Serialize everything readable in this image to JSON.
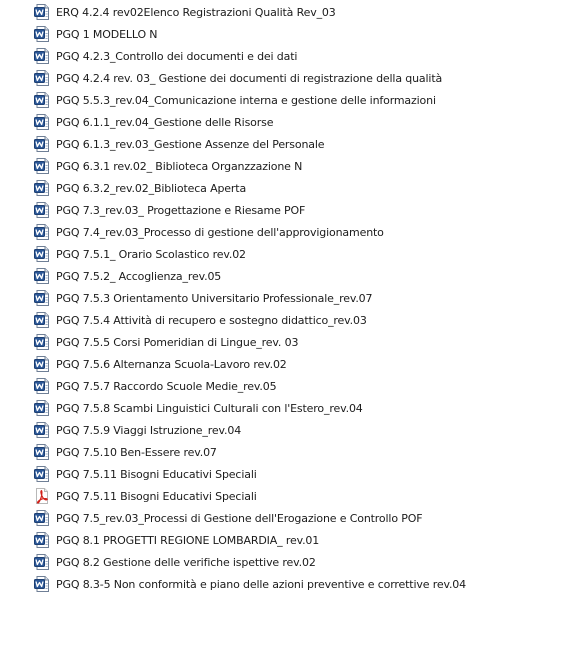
{
  "files": [
    {
      "name": "ERQ 4.2.4 rev02Elenco Registrazioni Qualità Rev_03",
      "icon": "word-doc-icon"
    },
    {
      "name": "PGQ 1 MODELLO N",
      "icon": "word-doc-icon"
    },
    {
      "name": "PGQ 4.2.3_Controllo dei documenti e dei dati",
      "icon": "word-doc-icon"
    },
    {
      "name": "PGQ 4.2.4  rev. 03_ Gestione dei documenti di registrazione della qualità",
      "icon": "word-doc-icon"
    },
    {
      "name": "PGQ 5.5.3_rev.04_Comunicazione interna e gestione delle informazioni",
      "icon": "word-doc-icon"
    },
    {
      "name": "PGQ 6.1.1_rev.04_Gestione delle Risorse",
      "icon": "word-doc-icon"
    },
    {
      "name": "PGQ 6.1.3_rev.03_Gestione Assenze del Personale",
      "icon": "word-doc-icon"
    },
    {
      "name": "PGQ 6.3.1 rev.02_ Biblioteca Organzzazione N",
      "icon": "word-doc-icon"
    },
    {
      "name": "PGQ 6.3.2_rev.02_Biblioteca Aperta",
      "icon": "word-doc-icon"
    },
    {
      "name": "PGQ 7.3_rev.03_ Progettazione e Riesame POF",
      "icon": "word-doc-icon"
    },
    {
      "name": "PGQ 7.4_rev.03_Processo di gestione dell'approvigionamento",
      "icon": "word-doc-icon"
    },
    {
      "name": "PGQ 7.5.1_ Orario Scolastico rev.02",
      "icon": "word-doc-icon"
    },
    {
      "name": "PGQ 7.5.2_ Accoglienza_rev.05",
      "icon": "word-doc-icon"
    },
    {
      "name": "PGQ 7.5.3 Orientamento Universitario Professionale_rev.07",
      "icon": "word-doc-icon"
    },
    {
      "name": "PGQ 7.5.4 Attività di recupero e sostegno didattico_rev.03",
      "icon": "word-doc-icon"
    },
    {
      "name": "PGQ 7.5.5 Corsi Pomeridian di Lingue_rev. 03",
      "icon": "word-doc-icon"
    },
    {
      "name": "PGQ 7.5.6 Alternanza Scuola-Lavoro rev.02",
      "icon": "word-doc-icon"
    },
    {
      "name": "PGQ 7.5.7 Raccordo Scuole Medie_rev.05",
      "icon": "word-doc-icon"
    },
    {
      "name": "PGQ 7.5.8 Scambi Linguistici Culturali con l'Estero_rev.04",
      "icon": "word-doc-icon"
    },
    {
      "name": "PGQ 7.5.9 Viaggi Istruzione_rev.04",
      "icon": "word-doc-icon"
    },
    {
      "name": "PGQ 7.5.10 Ben-Essere rev.07",
      "icon": "word-doc-icon"
    },
    {
      "name": "PGQ 7.5.11 Bisogni Educativi Speciali",
      "icon": "word-doc-icon"
    },
    {
      "name": "PGQ 7.5.11 Bisogni Educativi Speciali",
      "icon": "pdf-doc-icon"
    },
    {
      "name": "PGQ 7.5_rev.03_Processi di Gestione dell'Erogazione e Controllo POF",
      "icon": "word-doc-icon"
    },
    {
      "name": "PGQ 8.1  PROGETTI REGIONE LOMBARDIA_ rev.01",
      "icon": "word-doc-icon"
    },
    {
      "name": "PGQ 8.2 Gestione delle verifiche ispettive rev.02",
      "icon": "word-doc-icon"
    },
    {
      "name": "PGQ 8.3-5  Non conformità e piano delle azioni preventive e correttive  rev.04",
      "icon": "word-doc-icon"
    }
  ]
}
